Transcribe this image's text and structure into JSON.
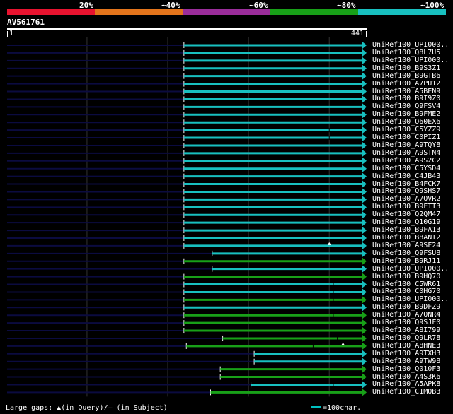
{
  "legend": {
    "bands": [
      {
        "label": "20%",
        "color": "#e8132f"
      },
      {
        "label": "~40%",
        "color": "#e4751c"
      },
      {
        "label": "~60%",
        "color": "#9b2d9b"
      },
      {
        "label": "~80%",
        "color": "#18a018"
      },
      {
        "label": "~100%",
        "color": "#18c0c0"
      }
    ]
  },
  "query": {
    "name": "AV561761",
    "start": "1",
    "end": "441"
  },
  "colors": {
    "background": "#000000",
    "left_trace": "#0b0b40",
    "grid": "#333333",
    "cyan": "#18c0c0",
    "green": "#18a018"
  },
  "hits": [
    {
      "label": "UniRef100_UPI000..",
      "start": 220,
      "end": 441,
      "identity": "~100%"
    },
    {
      "label": "UniRef100_Q8L7U5",
      "start": 220,
      "end": 441,
      "identity": "~100%"
    },
    {
      "label": "UniRef100_UPI000..",
      "start": 220,
      "end": 441,
      "identity": "~100%"
    },
    {
      "label": "UniRef100_B9S3Z1",
      "start": 220,
      "end": 441,
      "identity": "~100%"
    },
    {
      "label": "UniRef100_B9GTB6",
      "start": 220,
      "end": 441,
      "identity": "~100%"
    },
    {
      "label": "UniRef100_A7PU12",
      "start": 220,
      "end": 441,
      "identity": "~100%"
    },
    {
      "label": "UniRef100_A5BEN9",
      "start": 220,
      "end": 441,
      "identity": "~100%"
    },
    {
      "label": "UniRef100_B9I9Z0",
      "start": 220,
      "end": 441,
      "identity": "~100%"
    },
    {
      "label": "UniRef100_Q9FSV4",
      "start": 220,
      "end": 441,
      "identity": "~100%"
    },
    {
      "label": "UniRef100_B9FME2",
      "start": 220,
      "end": 441,
      "identity": "~100%"
    },
    {
      "label": "UniRef100_Q60EX6",
      "start": 220,
      "end": 441,
      "identity": "~100%"
    },
    {
      "label": "UniRef100_C5YZZ9",
      "start": 220,
      "end": 441,
      "identity": "~100%",
      "gap": 400
    },
    {
      "label": "UniRef100_C0PIZ1",
      "start": 220,
      "end": 441,
      "identity": "~100%",
      "gap": 400
    },
    {
      "label": "UniRef100_A9TQY8",
      "start": 220,
      "end": 441,
      "identity": "~100%"
    },
    {
      "label": "UniRef100_A9STN4",
      "start": 220,
      "end": 441,
      "identity": "~100%"
    },
    {
      "label": "UniRef100_A9S2C2",
      "start": 220,
      "end": 441,
      "identity": "~100%"
    },
    {
      "label": "UniRef100_C5YSD4",
      "start": 220,
      "end": 441,
      "identity": "~100%"
    },
    {
      "label": "UniRef100_C4JB43",
      "start": 220,
      "end": 441,
      "identity": "~100%"
    },
    {
      "label": "UniRef100_B4FCK7",
      "start": 220,
      "end": 441,
      "identity": "~100%"
    },
    {
      "label": "UniRef100_Q9SHS7",
      "start": 220,
      "end": 441,
      "identity": "~100%"
    },
    {
      "label": "UniRef100_A7QVR2",
      "start": 220,
      "end": 441,
      "identity": "~100%"
    },
    {
      "label": "UniRef100_B9FTT3",
      "start": 220,
      "end": 441,
      "identity": "~100%"
    },
    {
      "label": "UniRef100_Q2QM47",
      "start": 220,
      "end": 441,
      "identity": "~100%"
    },
    {
      "label": "UniRef100_Q10G19",
      "start": 220,
      "end": 441,
      "identity": "~100%"
    },
    {
      "label": "UniRef100_B9FA13",
      "start": 220,
      "end": 441,
      "identity": "~100%"
    },
    {
      "label": "UniRef100_B8ANI2",
      "start": 220,
      "end": 441,
      "identity": "~100%"
    },
    {
      "label": "UniRef100_A9SF24",
      "start": 220,
      "end": 441,
      "identity": "~100%",
      "query_gap": 400
    },
    {
      "label": "UniRef100_Q9FSU8",
      "start": 255,
      "end": 441,
      "identity": "~100%"
    },
    {
      "label": "UniRef100_B9RJ11",
      "start": 220,
      "end": 441,
      "identity": "~80%"
    },
    {
      "label": "UniRef100_UPI000..",
      "start": 255,
      "end": 441,
      "identity": "~100%"
    },
    {
      "label": "UniRef100_B9HQ70",
      "start": 220,
      "end": 441,
      "identity": "~80%"
    },
    {
      "label": "UniRef100_C5WR61",
      "start": 220,
      "end": 441,
      "identity": "~100%",
      "gap": 405
    },
    {
      "label": "UniRef100_C0HG70",
      "start": 220,
      "end": 441,
      "identity": "~100%",
      "gap": 405
    },
    {
      "label": "UniRef100_UPI000..",
      "start": 220,
      "end": 441,
      "identity": "~80%",
      "gap": 405
    },
    {
      "label": "UniRef100_B9DFZ9",
      "start": 220,
      "end": 441,
      "identity": "~100%"
    },
    {
      "label": "UniRef100_A7QNR4",
      "start": 220,
      "end": 441,
      "identity": "~80%",
      "gap": 405
    },
    {
      "label": "UniRef100_Q9SJF0",
      "start": 220,
      "end": 441,
      "identity": "~80%"
    },
    {
      "label": "UniRef100_A8I799",
      "start": 220,
      "end": 441,
      "identity": "~80%"
    },
    {
      "label": "UniRef100_Q9LR78",
      "start": 268,
      "end": 441,
      "identity": "~80%",
      "gap": 410
    },
    {
      "label": "UniRef100_A8HNE3",
      "start": 223,
      "end": 441,
      "identity": "~80%",
      "gap": 380,
      "query_gap": 417
    },
    {
      "label": "UniRef100_A9TXH3",
      "start": 307,
      "end": 441,
      "identity": "~100%"
    },
    {
      "label": "UniRef100_A9TW98",
      "start": 307,
      "end": 441,
      "identity": "~100%"
    },
    {
      "label": "UniRef100_Q010F3",
      "start": 265,
      "end": 441,
      "identity": "~80%"
    },
    {
      "label": "UniRef100_A4S3K6",
      "start": 265,
      "end": 441,
      "identity": "~80%"
    },
    {
      "label": "UniRef100_A5APK8",
      "start": 303,
      "end": 441,
      "identity": "~100%",
      "gap": 405
    },
    {
      "label": "UniRef100_C1MQB3",
      "start": 253,
      "end": 441,
      "identity": "~80%"
    }
  ],
  "footer": {
    "large_gaps": "Large gaps: ▲(in Query)/– (in Subject)",
    "scale": "=100char."
  }
}
